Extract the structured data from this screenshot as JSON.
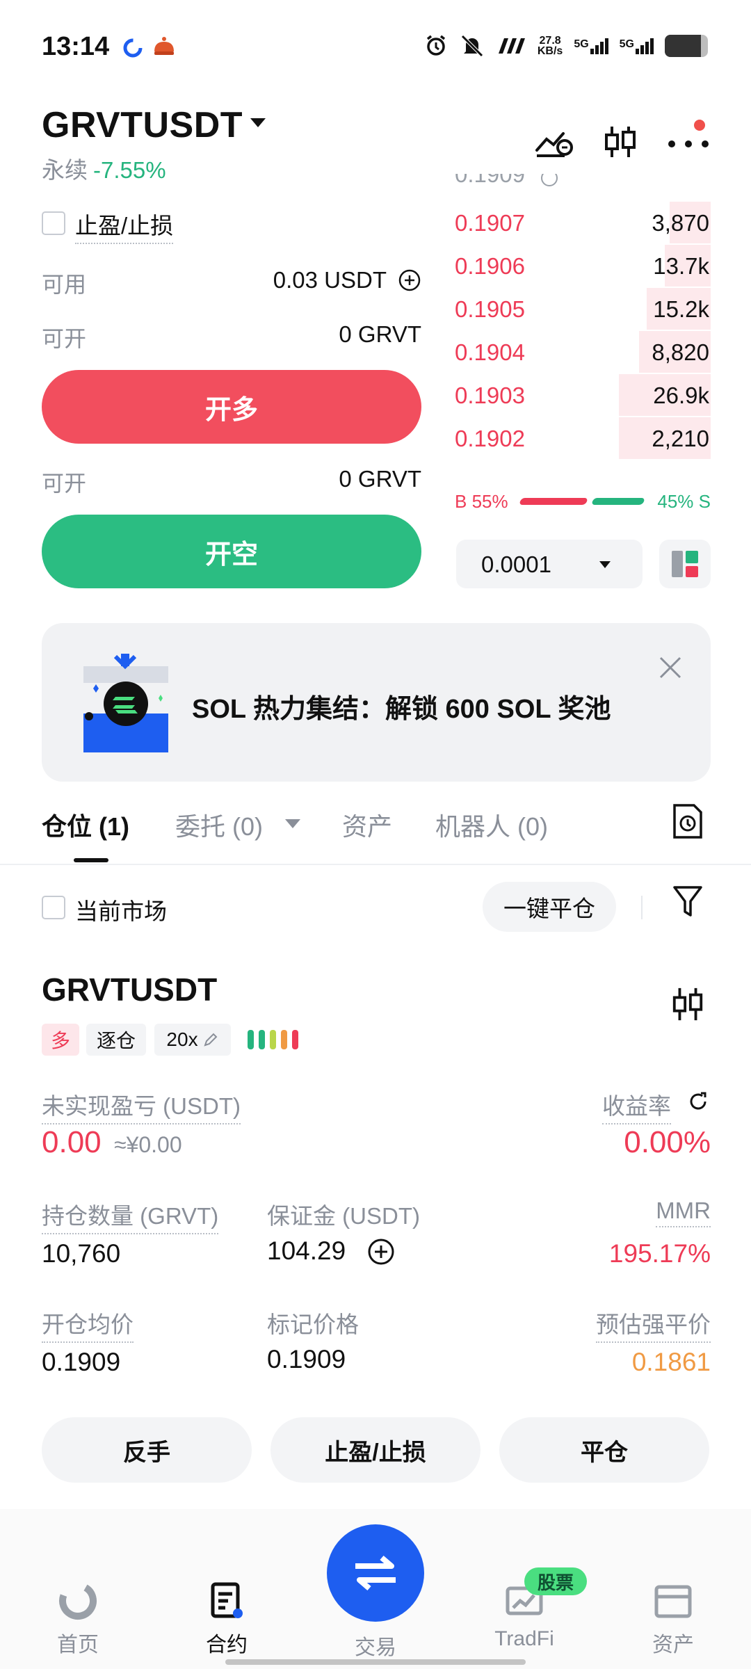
{
  "status_bar": {
    "time": "13:14",
    "net_speed_value": "27.8",
    "net_speed_unit": "KB/s",
    "sim1": "5G",
    "sim2": "5G"
  },
  "header": {
    "pair": "GRVTUSDT",
    "type": "永续",
    "change": "-7.55%"
  },
  "order_form": {
    "tp_sl_label": "止盈/止损",
    "available_label": "可用",
    "available_value": "0.03 USDT",
    "can_open_label": "可开",
    "can_open_value": "0 GRVT",
    "long_button": "开多",
    "can_open_label_2": "可开",
    "can_open_value_2": "0 GRVT",
    "short_button": "开空"
  },
  "order_book": {
    "top_partial": "0.1909",
    "asks": [
      {
        "price": "0.1907",
        "qty": "3,870",
        "depth": 0.16
      },
      {
        "price": "0.1906",
        "qty": "13.7k",
        "depth": 0.18
      },
      {
        "price": "0.1905",
        "qty": "15.2k",
        "depth": 0.25
      },
      {
        "price": "0.1904",
        "qty": "8,820",
        "depth": 0.28
      },
      {
        "price": "0.1903",
        "qty": "26.9k",
        "depth": 0.36
      },
      {
        "price": "0.1902",
        "qty": "2,210",
        "depth": 0.36
      }
    ],
    "buy_ratio": "B 55%",
    "sell_ratio": "45% S",
    "tick_size": "0.0001"
  },
  "banner": {
    "text": "SOL 热力集结：解锁 600 SOL 奖池"
  },
  "tabs": [
    {
      "label": "仓位 (1)"
    },
    {
      "label": "委托 (0)"
    },
    {
      "label": "资产"
    },
    {
      "label": "机器人 (0)"
    }
  ],
  "filters": {
    "current_market": "当前市场",
    "close_all": "一键平仓"
  },
  "position": {
    "pair": "GRVTUSDT",
    "side": "多",
    "margin_mode": "逐仓",
    "leverage": "20x",
    "unrealized_pnl_label": "未实现盈亏 (USDT)",
    "unrealized_pnl": "0.00",
    "unrealized_pnl_cny": "≈¥0.00",
    "roe_label": "收益率",
    "roe": "0.00%",
    "size_label": "持仓数量 (GRVT)",
    "size": "10,760",
    "margin_label": "保证金 (USDT)",
    "margin": "104.29",
    "mmr_label": "MMR",
    "mmr": "195.17%",
    "entry_label": "开仓均价",
    "entry": "0.1909",
    "mark_label": "标记价格",
    "mark": "0.1909",
    "liq_label": "预估强平价",
    "liq": "0.1861",
    "btn_reverse": "反手",
    "btn_tpsl": "止盈/止损",
    "btn_close": "平仓"
  },
  "nav": {
    "home": "首页",
    "futures": "合约",
    "trade": "交易",
    "tradfi": "TradFi",
    "tradfi_badge": "股票",
    "assets": "资产"
  },
  "colors": {
    "red": "#ee3b56",
    "green": "#25b47e",
    "blue": "#1e5ef0",
    "orange": "#f09a43"
  }
}
